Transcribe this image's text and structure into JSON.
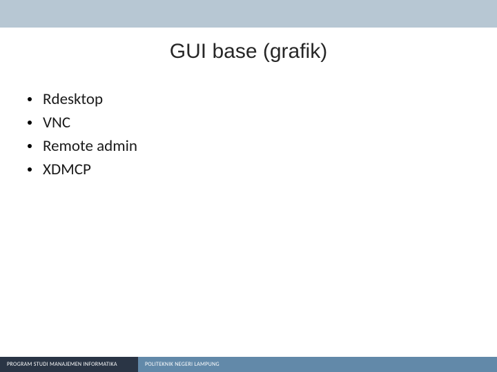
{
  "title": "GUI base (grafik)",
  "bullets": {
    "0": "Rdesktop",
    "1": "VNC",
    "2": "Remote admin",
    "3": "XDMCP"
  },
  "footer": {
    "left": "PROGRAM STUDI MANAJEMEN INFORMATIKA",
    "right": "POLITEKNIK NEGERI LAMPUNG"
  }
}
